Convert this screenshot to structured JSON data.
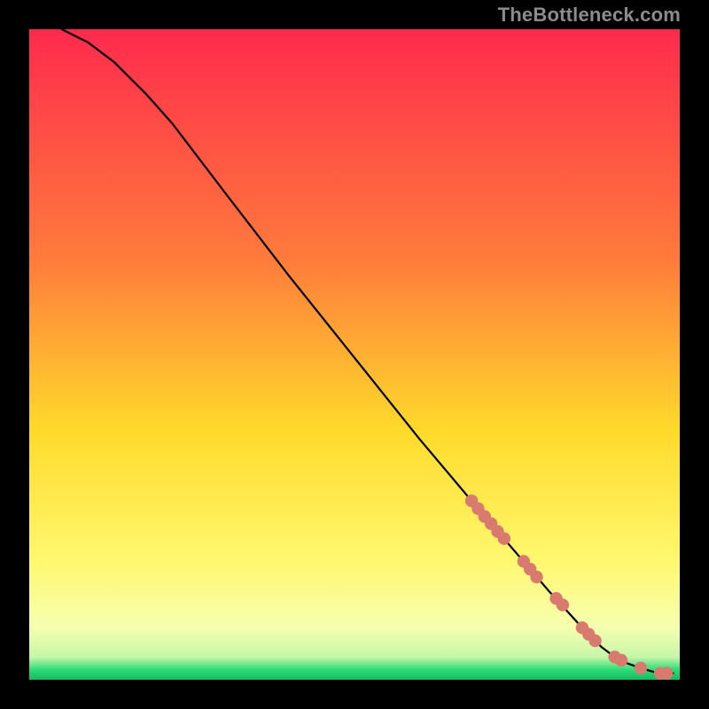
{
  "watermark": "TheBottleneck.com",
  "colors": {
    "top": "#ff2a4d",
    "mid1": "#ff7a3c",
    "mid2": "#ffdb2b",
    "mid3": "#fff870",
    "green": "#2bdc76",
    "line": "#000000",
    "dot": "#d87b6e",
    "plot_border": "#000000"
  },
  "chart_data": {
    "type": "line",
    "title": "",
    "xlabel": "",
    "ylabel": "",
    "xlim": [
      0,
      100
    ],
    "ylim": [
      0,
      100
    ],
    "series": [
      {
        "name": "curve",
        "x": [
          5,
          7,
          9,
          11,
          13,
          15,
          18,
          22,
          30,
          40,
          50,
          60,
          68,
          74,
          80,
          85,
          88,
          90,
          92,
          94,
          96,
          98,
          99
        ],
        "y": [
          100,
          99,
          98,
          96.5,
          95,
          93,
          90,
          85.5,
          75,
          62,
          49.5,
          37,
          27.5,
          20.5,
          13.5,
          8,
          5,
          3.5,
          2.5,
          1.8,
          1.2,
          1,
          1
        ]
      }
    ],
    "markers": [
      {
        "x": 68.0,
        "y": 27.5
      },
      {
        "x": 69.0,
        "y": 26.3
      },
      {
        "x": 70.0,
        "y": 25.1
      },
      {
        "x": 71.0,
        "y": 24.0
      },
      {
        "x": 72.0,
        "y": 22.8
      },
      {
        "x": 73.0,
        "y": 21.7
      },
      {
        "x": 76.0,
        "y": 18.2
      },
      {
        "x": 77.0,
        "y": 17.0
      },
      {
        "x": 78.0,
        "y": 15.8
      },
      {
        "x": 81.0,
        "y": 12.5
      },
      {
        "x": 82.0,
        "y": 11.5
      },
      {
        "x": 85.0,
        "y": 8.0
      },
      {
        "x": 86.0,
        "y": 7.0
      },
      {
        "x": 87.0,
        "y": 6.0
      },
      {
        "x": 90.0,
        "y": 3.5
      },
      {
        "x": 91.0,
        "y": 3.0
      },
      {
        "x": 94.0,
        "y": 1.8
      },
      {
        "x": 97.0,
        "y": 1.0
      },
      {
        "x": 98.0,
        "y": 1.0
      }
    ]
  }
}
